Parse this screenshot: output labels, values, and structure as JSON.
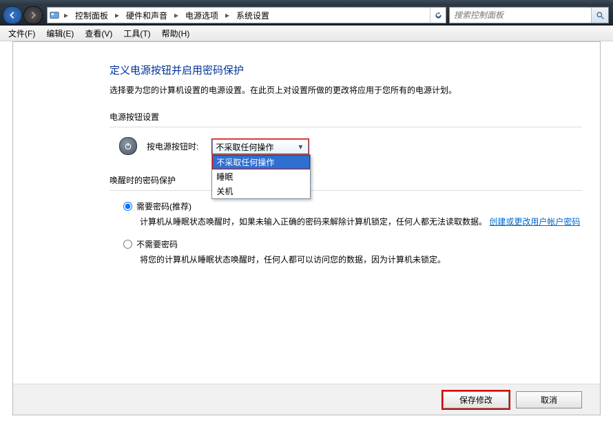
{
  "nav": {
    "crumbs": [
      "控制面板",
      "硬件和声音",
      "电源选项",
      "系统设置"
    ],
    "search_placeholder": "搜索控制面板"
  },
  "menu": {
    "file": "文件(F)",
    "edit": "编辑(E)",
    "view": "查看(V)",
    "tools": "工具(T)",
    "help": "帮助(H)"
  },
  "page": {
    "title": "定义电源按钮并启用密码保护",
    "desc": "选择要为您的计算机设置的电源设置。在此页上对设置所做的更改将应用于您所有的电源计划。",
    "section_power": "电源按钮设置",
    "power_label": "按电源按钮时:",
    "combo_selected": "不采取任何操作",
    "combo_options": [
      "不采取任何操作",
      "睡眠",
      "关机"
    ],
    "section_wake": "唤醒时的密码保护",
    "opt_need_pw": "需要密码(推荐)",
    "opt_need_pw_desc_a": "计算机从睡眠状态唤醒时，如果未输入正确的密码来解除计算机锁定，任何人都无法读取数据。",
    "opt_need_pw_link": "创建或更改用户帐户密码",
    "opt_no_pw": "不需要密码",
    "opt_no_pw_desc": "将您的计算机从睡眠状态唤醒时，任何人都可以访问您的数据，因为计算机未锁定。"
  },
  "footer": {
    "save": "保存修改",
    "cancel": "取消"
  }
}
